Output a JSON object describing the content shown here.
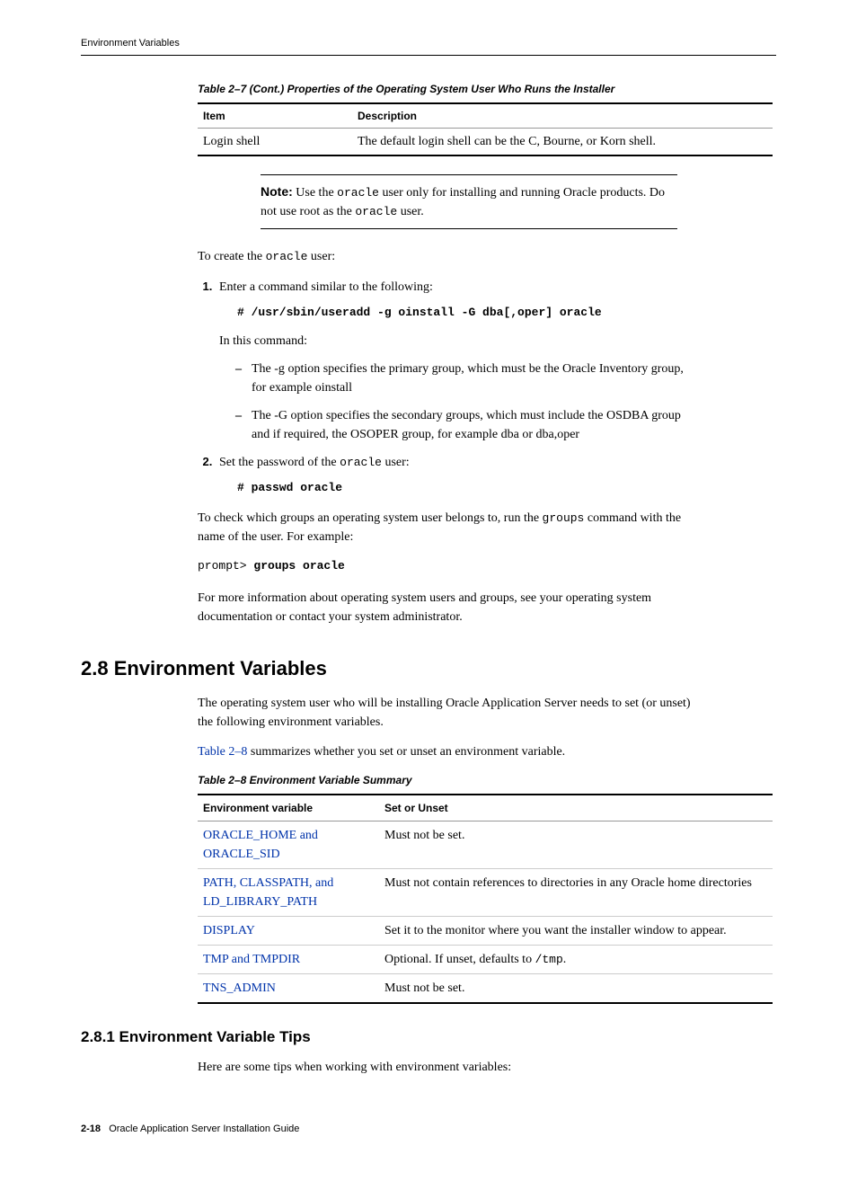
{
  "header": {
    "running_title": "Environment Variables"
  },
  "table27": {
    "caption": "Table 2–7   (Cont.)  Properties of the Operating System User Who Runs the Installer",
    "col1": "Item",
    "col2": "Description",
    "row_item": "Login shell",
    "row_desc": "The default login shell can be the C, Bourne, or Korn shell."
  },
  "note": {
    "label": "Note:",
    "text_pre": "   Use the ",
    "code1": "oracle",
    "text_mid": " user only for installing and running Oracle products. Do not use root as the ",
    "code2": "oracle",
    "text_end": " user."
  },
  "p_create_pre": "To create the ",
  "p_create_code": "oracle",
  "p_create_post": " user:",
  "step1": {
    "text": "Enter a command similar to the following:",
    "code": "# /usr/sbin/useradd -g oinstall -G dba[,oper] oracle",
    "subpara": "In this command:",
    "bullet1_pre": "The ",
    "bullet1_code": "-g",
    "bullet1_mid": " option specifies the primary group, which must be the Oracle Inventory group, for example ",
    "bullet1_code2": "oinstall",
    "bullet2_pre": "The ",
    "bullet2_code": "-G",
    "bullet2_mid": " option specifies the secondary groups, which must include the OSDBA group and if required, the OSOPER group, for example ",
    "bullet2_code2": "dba",
    "bullet2_or": " or ",
    "bullet2_code3": "dba,oper"
  },
  "step2": {
    "text_pre": "Set the password of the ",
    "text_code": "oracle",
    "text_post": " user:",
    "code": "# passwd oracle"
  },
  "p_check": {
    "pre": "To check which groups an operating system user belongs to, run the ",
    "code": "groups",
    "post": " command with the name of the user. For example:"
  },
  "prompt_code_pre": "prompt> ",
  "prompt_code_bold": "groups oracle",
  "p_more": "For more information about operating system users and groups, see your operating system documentation or contact your system administrator.",
  "sec28": {
    "heading": "2.8  Environment Variables",
    "p1": "The operating system user who will be installing Oracle Application Server needs to set (or unset) the following environment variables.",
    "p2_link": "Table 2–8",
    "p2_rest": " summarizes whether you set or unset an environment variable."
  },
  "table28": {
    "caption": "Table 2–8    Environment Variable Summary",
    "col1": "Environment variable",
    "col2": "Set or Unset",
    "rows": [
      {
        "c1": "ORACLE_HOME and ORACLE_SID",
        "c2": "Must not be set."
      },
      {
        "c1": "PATH, CLASSPATH, and LD_LIBRARY_PATH",
        "c2": "Must not contain references to directories in any Oracle home directories"
      },
      {
        "c1": "DISPLAY",
        "c2": "Set it to the monitor where you want the installer window to appear."
      },
      {
        "c1": "TMP and TMPDIR",
        "c2_pre": "Optional. If unset, defaults to ",
        "c2_code": "/tmp",
        "c2_post": "."
      },
      {
        "c1": "TNS_ADMIN",
        "c2": "Must not be set."
      }
    ]
  },
  "sec281": {
    "heading": "2.8.1  Environment Variable Tips",
    "p1": "Here are some tips when working with environment variables:"
  },
  "footer": {
    "page": "2-18",
    "title": "Oracle Application Server Installation Guide"
  }
}
